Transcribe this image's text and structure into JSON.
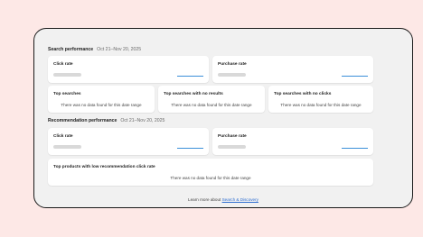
{
  "search_performance": {
    "title": "Search performance",
    "date_range": "Oct 21–Nov 20, 2025",
    "click_rate_label": "Click rate",
    "purchase_rate_label": "Purchase rate",
    "top_searches": {
      "title": "Top searches",
      "message": "There was no data found for this date range"
    },
    "top_no_results": {
      "title": "Top searches with no results",
      "message": "There was no data found for this date range"
    },
    "top_no_clicks": {
      "title": "Top searches with no clicks",
      "message": "There was no data found for this date range"
    }
  },
  "recommendation_performance": {
    "title": "Recommendation performance",
    "date_range": "Oct 21–Nov 20, 2025",
    "click_rate_label": "Click rate",
    "purchase_rate_label": "Purchase rate",
    "low_click_products": {
      "title": "Top products with low recommendation click rate",
      "message": "There was no data found for this date range"
    }
  },
  "footer": {
    "prefix": "Learn more about ",
    "link": "Search & Discovery"
  },
  "colors": {
    "page_background": "#fde8e6",
    "panel_background": "#f1f1f1",
    "accent_line": "#3b8fd9",
    "link": "#2f6fd1"
  }
}
